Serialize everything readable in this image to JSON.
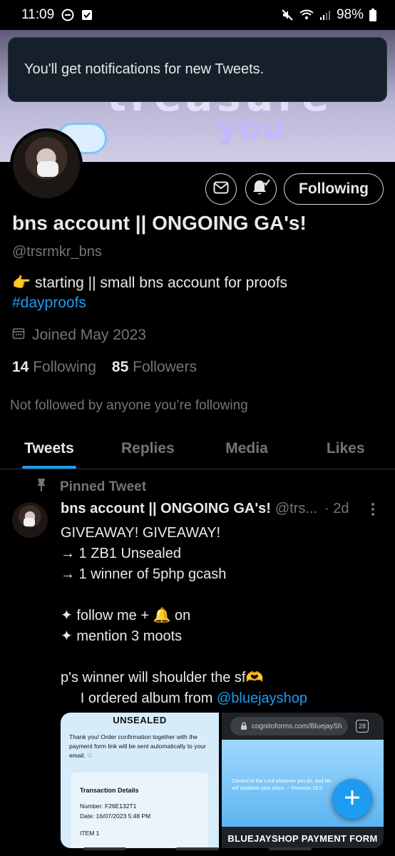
{
  "status_bar": {
    "time": "11:09",
    "battery": "98%"
  },
  "banner": {
    "word_top": "treasure",
    "word_bottom": "you"
  },
  "toast": {
    "message": "You'll get notifications for new Tweets."
  },
  "actions": {
    "follow_label": "Following"
  },
  "profile": {
    "name": "bns account || ONGOING GA's!",
    "handle": "@trsrmkr_bns",
    "bio_text": "👉 starting || small bns account for proofs",
    "bio_hashtag": "#dayproofs",
    "joined": "Joined May 2023",
    "following_count": "14",
    "following_label": "Following",
    "followers_count": "85",
    "followers_label": "Followers",
    "not_followed": "Not followed by anyone you’re following"
  },
  "tabs": [
    "Tweets",
    "Replies",
    "Media",
    "Likes"
  ],
  "tweet": {
    "pinned_label": "Pinned Tweet",
    "name": "bns account || ONGOING GA's!",
    "handle": "@trs...",
    "time": "· 2d",
    "body": "GIVEAWAY! GIVEAWAY!\n→ 1 ZB1 Unsealed\n→ 1 winner of 5php gcash\n\n✦ follow me + 🔔 on\n✦ mention 3 moots\n\np's winner will shoulder the sf🫶\n     I ordered album from ",
    "mention": "@bluejayshop"
  },
  "media": {
    "left_title": "UNSEALED",
    "left_text": "Thank you! Order confirmation together with the payment form link will be sent automatically to your email. ♡",
    "card_title": "Transaction Details",
    "card_number": "Number:   F26E132T1",
    "card_date": "Date:        16/07/2023 5:48 PM",
    "card_item": "ITEM 1",
    "right_url": "cognitoforms.com/BluejaySh",
    "right_tabs": "28",
    "right_verse": "Commit to the Lord whatever you do, and He will establish your plans. ~ Proverbs 16:3",
    "right_banner": "BLUEJAYSHOP PAYMENT FORM"
  },
  "colors": {
    "accent": "#1d9bf0",
    "background": "#000000",
    "secondary_text": "#71767b"
  }
}
